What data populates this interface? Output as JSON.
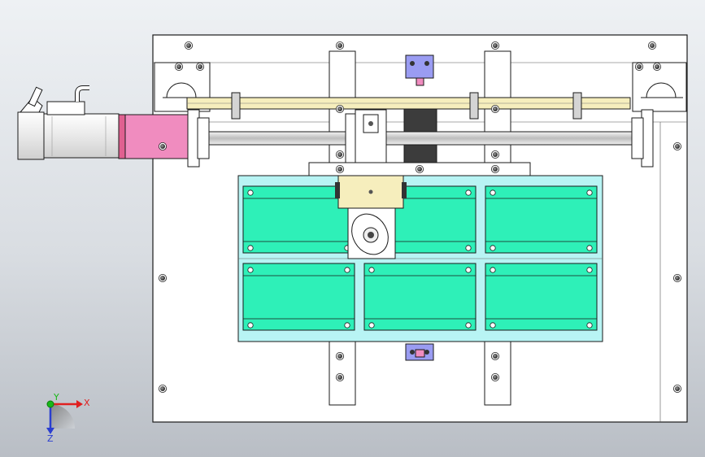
{
  "view": {
    "background_top": "#eef1f4",
    "background_bottom": "#b9bec5"
  },
  "model": {
    "plate_color": "#ffffff",
    "outline_color": "#1a1a1a",
    "table_color": "#b8f4f4",
    "block_color": "#2ef0b8",
    "motor_coupling_color": "#f08cbf",
    "carriage_color": "#f6eebd",
    "limit_switch_color": "#9a9cf2",
    "dark_slot_color": "#3c3c3c"
  },
  "triad": {
    "x_label": "X",
    "y_label": "Y",
    "z_label": "Z",
    "x_color": "#e02020",
    "y_color": "#18b818",
    "z_color": "#2a3ed0"
  }
}
